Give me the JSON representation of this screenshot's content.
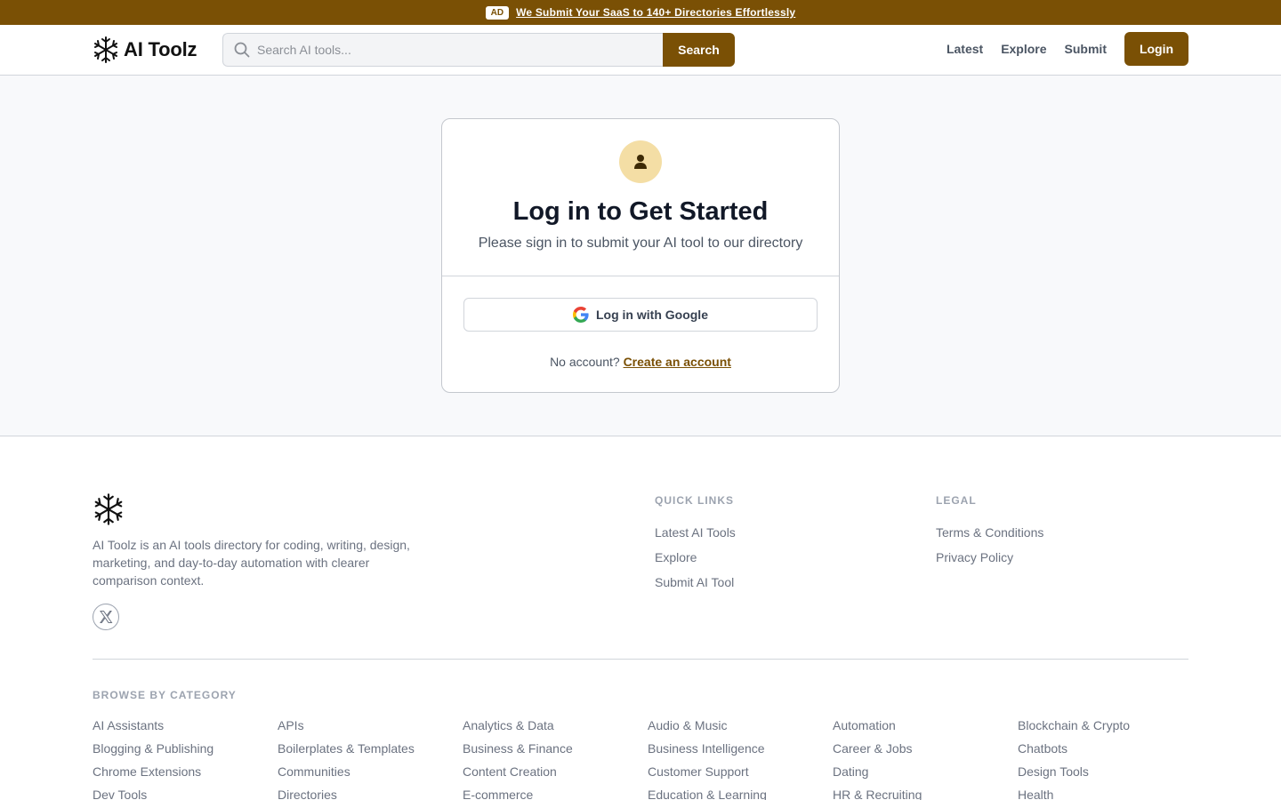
{
  "ad_banner": {
    "badge": "AD",
    "text": "We Submit Your SaaS to 140+ Directories Effortlessly"
  },
  "header": {
    "logo_text": "AI Toolz",
    "search_placeholder": "Search AI tools...",
    "search_button": "Search",
    "nav": [
      "Latest",
      "Explore",
      "Submit"
    ],
    "login_button": "Login"
  },
  "login_card": {
    "icon": "user-icon",
    "title": "Log in to Get Started",
    "subtitle": "Please sign in to submit your AI tool to our directory",
    "google_button": "Log in with Google",
    "no_account_text": "No account?",
    "create_account_link": "Create an account"
  },
  "footer": {
    "description": "AI Toolz is an AI tools directory for coding, writing, design, marketing, and day-to-day automation with clearer comparison context.",
    "social_icon": "x-twitter-icon",
    "quick_links": {
      "title": "QUICK LINKS",
      "items": [
        "Latest AI Tools",
        "Explore",
        "Submit AI Tool"
      ]
    },
    "legal": {
      "title": "LEGAL",
      "items": [
        "Terms & Conditions",
        "Privacy Policy"
      ]
    },
    "browse": {
      "title": "BROWSE BY CATEGORY",
      "categories": [
        "AI Assistants",
        "APIs",
        "Analytics & Data",
        "Audio & Music",
        "Automation",
        "Blockchain & Crypto",
        "Blogging & Publishing",
        "Boilerplates & Templates",
        "Business & Finance",
        "Business Intelligence",
        "Career & Jobs",
        "Chatbots",
        "Chrome Extensions",
        "Communities",
        "Content Creation",
        "Customer Support",
        "Dating",
        "Design Tools",
        "Dev Tools",
        "Directories",
        "E-commerce",
        "Education & Learning",
        "HR & Recruiting",
        "Health"
      ]
    }
  },
  "colors": {
    "brand": "#7a5005",
    "avatar_bg": "#f4dea5"
  }
}
